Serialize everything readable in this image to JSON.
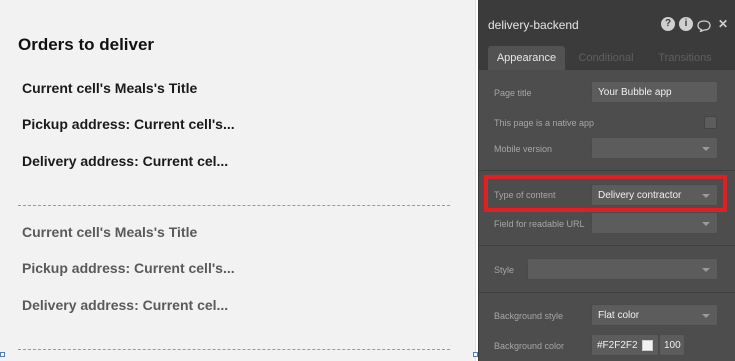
{
  "canvas": {
    "title": "Orders to deliver",
    "cells": [
      {
        "meal_title": "Current cell's Meals's Title",
        "pickup": "Pickup address: Current cell's...",
        "delivery": "Delivery address: Current cel..."
      },
      {
        "meal_title": "Current cell's Meals's Title",
        "pickup": "Pickup address: Current cell's...",
        "delivery": "Delivery address: Current cel..."
      }
    ]
  },
  "panel": {
    "title": "delivery-backend",
    "header_icons": [
      "help-icon",
      "info-icon",
      "comment-icon",
      "close-icon"
    ],
    "icon_glyphs": {
      "help": "?",
      "info": "i",
      "comment": "💬",
      "close": "✕"
    },
    "tabs": [
      {
        "label": "Appearance",
        "active": true
      },
      {
        "label": "Conditional",
        "active": false
      },
      {
        "label": "Transitions",
        "active": false
      }
    ],
    "page_title_label": "Page title",
    "page_title_value": "Your Bubble app",
    "native_app_label": "This page is a native app",
    "native_app_checked": false,
    "mobile_version_label": "Mobile version",
    "mobile_version_value": "",
    "type_of_content_label": "Type of content",
    "type_of_content_value": "Delivery contractor",
    "readable_url_label": "Field for readable URL",
    "readable_url_value": "",
    "style_label": "Style",
    "style_value": "",
    "bg_style_label": "Background style",
    "bg_style_value": "Flat color",
    "bg_color_label": "Background color",
    "bg_color_hex": "#F2F2F2",
    "bg_opacity": "100"
  },
  "colors": {
    "canvas_bg": "#f2f2f2",
    "panel_bg": "#4d4d4d",
    "panel_header": "#3b3b3b",
    "highlight": "#e02020"
  }
}
